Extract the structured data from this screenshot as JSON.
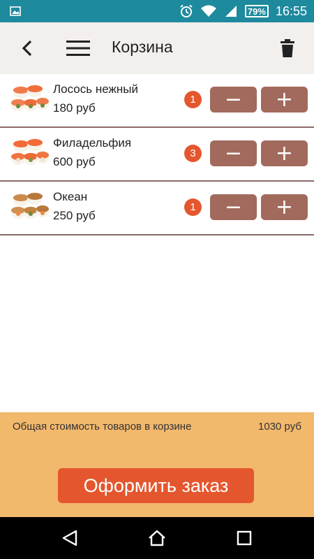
{
  "status_bar": {
    "time": "16:55",
    "battery": "79%",
    "icons": [
      "image-icon",
      "alarm-icon",
      "wifi-icon",
      "signal-icon",
      "battery-icon"
    ]
  },
  "toolbar": {
    "title": "Корзина",
    "icons": {
      "back": "back-arrow-icon",
      "menu": "hamburger-menu-icon",
      "delete": "trash-icon"
    }
  },
  "cart": {
    "items": [
      {
        "name": "Лосось нежный",
        "price": "180 руб",
        "quantity": "1",
        "minus": "−",
        "plus": "+"
      },
      {
        "name": "Филадельфия",
        "price": "600 руб",
        "quantity": "3",
        "minus": "−",
        "plus": "+"
      },
      {
        "name": "Океан",
        "price": "250 руб",
        "quantity": "1",
        "minus": "−",
        "plus": "+"
      }
    ]
  },
  "footer": {
    "total_label": "Общая стоимость товаров в корзине",
    "total_value": "1030 руб",
    "order_button": "Оформить заказ"
  },
  "colors": {
    "status_bar": "#1e8a9e",
    "toolbar_bg": "#f3efec",
    "button_brown": "#a26a5c",
    "badge_accent": "#e4572e",
    "footer_bg": "#f2b86c",
    "divider": "#8a6a66"
  }
}
